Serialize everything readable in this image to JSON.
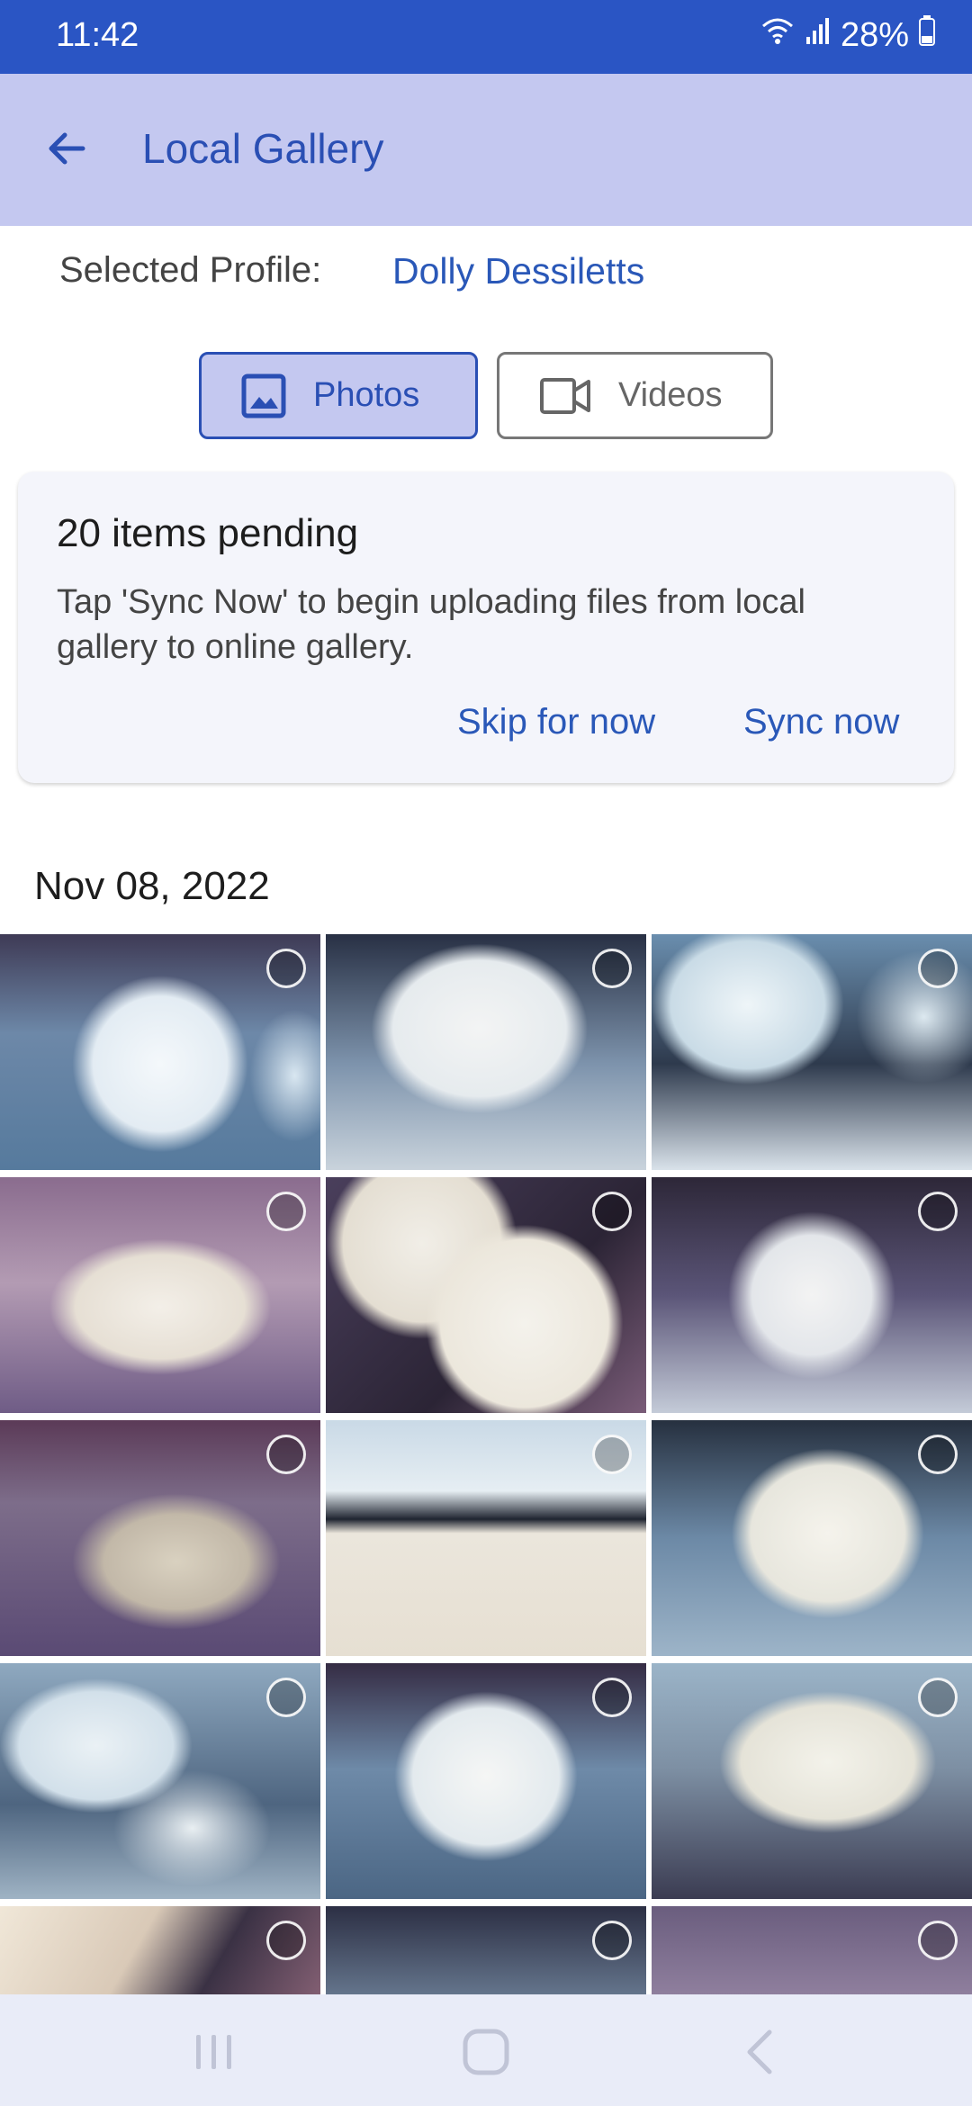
{
  "status_bar": {
    "time": "11:42",
    "battery": "28%"
  },
  "app_bar": {
    "title": "Local Gallery"
  },
  "profile": {
    "label": "Selected Profile:",
    "name": "Dolly Dessiletts"
  },
  "tabs": [
    {
      "label": "Photos",
      "selected": true
    },
    {
      "label": "Videos",
      "selected": false
    }
  ],
  "sync_card": {
    "heading": "20 items pending",
    "description": "Tap 'Sync Now' to begin uploading files from local gallery to online gallery.",
    "skip_label": "Skip for now",
    "sync_label": "Sync now"
  },
  "gallery": {
    "date": "Nov 08, 2022"
  },
  "colors": {
    "status_bar": "#2a55c4",
    "app_bar": "#c4c8f0",
    "accent": "#2a4fb4",
    "link": "#2a58b8"
  },
  "icons": [
    "back-arrow-icon",
    "wifi-icon",
    "signal-icon",
    "battery-icon",
    "image-icon",
    "video-camera-icon",
    "recents-icon",
    "home-icon",
    "back-icon"
  ]
}
